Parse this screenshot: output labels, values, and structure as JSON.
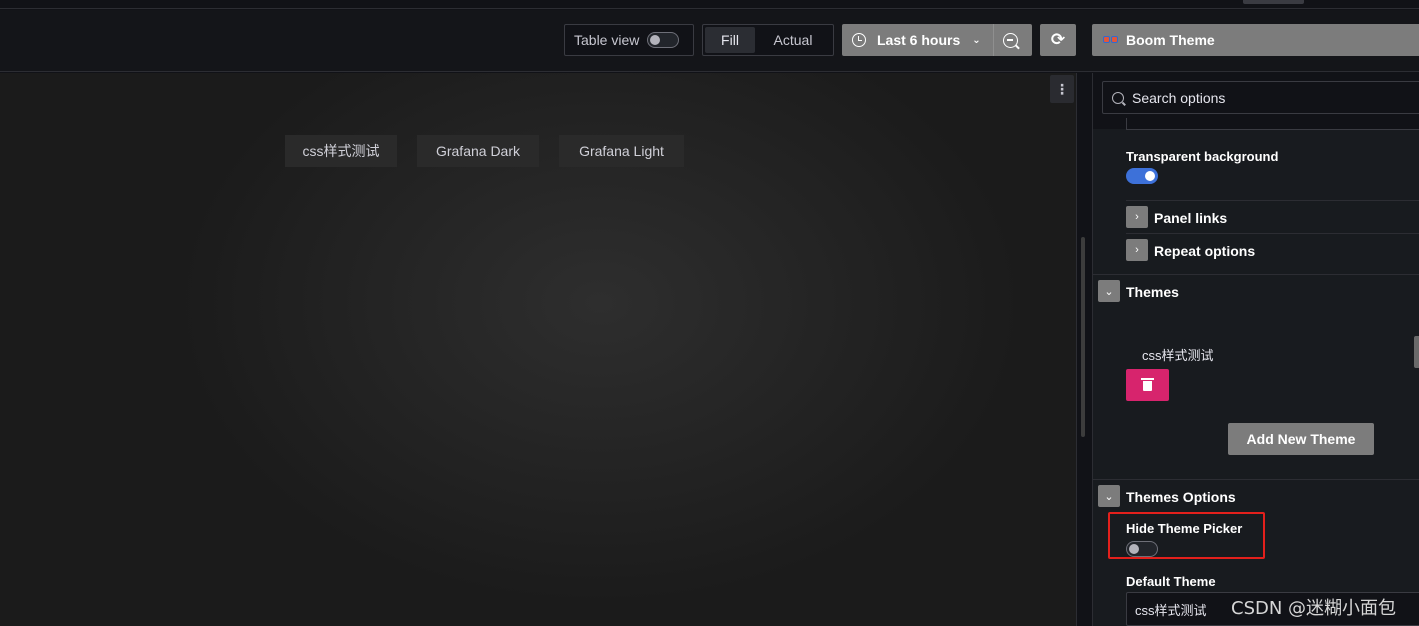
{
  "toolbar": {
    "table_view_label": "Table view",
    "table_view_on": false,
    "fill_label": "Fill",
    "actual_label": "Actual",
    "time_range_label": "Last 6 hours",
    "refresh_glyph": "⟳",
    "panel_plugin_label": "Boom Theme",
    "icons": [
      "clock-icon",
      "chevron-down-icon",
      "zoom-out-icon",
      "refresh-icon",
      "boom-theme-glasses-icon"
    ]
  },
  "canvas": {
    "menu_glyph": "⋮",
    "theme_tabs": [
      "css样式测试",
      "Grafana Dark",
      "Grafana Light"
    ]
  },
  "options_pane": {
    "search_placeholder": "Search options",
    "transparent_background_label": "Transparent background",
    "transparent_background_on": true,
    "panel_links_label": "Panel links",
    "repeat_options_label": "Repeat options",
    "collapsed_glyph": "›",
    "expanded_glyph": "⌄",
    "themes_section_title": "Themes",
    "themes": [
      {
        "name": "css样式测试"
      }
    ],
    "add_theme_label": "Add New Theme",
    "themes_options_title": "Themes Options",
    "hide_theme_picker_label": "Hide Theme Picker",
    "hide_theme_picker_on": false,
    "default_theme_label": "Default Theme",
    "default_theme_value": "css样式测试"
  },
  "colors": {
    "accent_blue": "#3d71d9",
    "danger_pink": "#d7246d",
    "highlight_red": "#e3201c",
    "button_gray": "#7c7c7c"
  },
  "watermark": "CSDN @迷糊小面包"
}
